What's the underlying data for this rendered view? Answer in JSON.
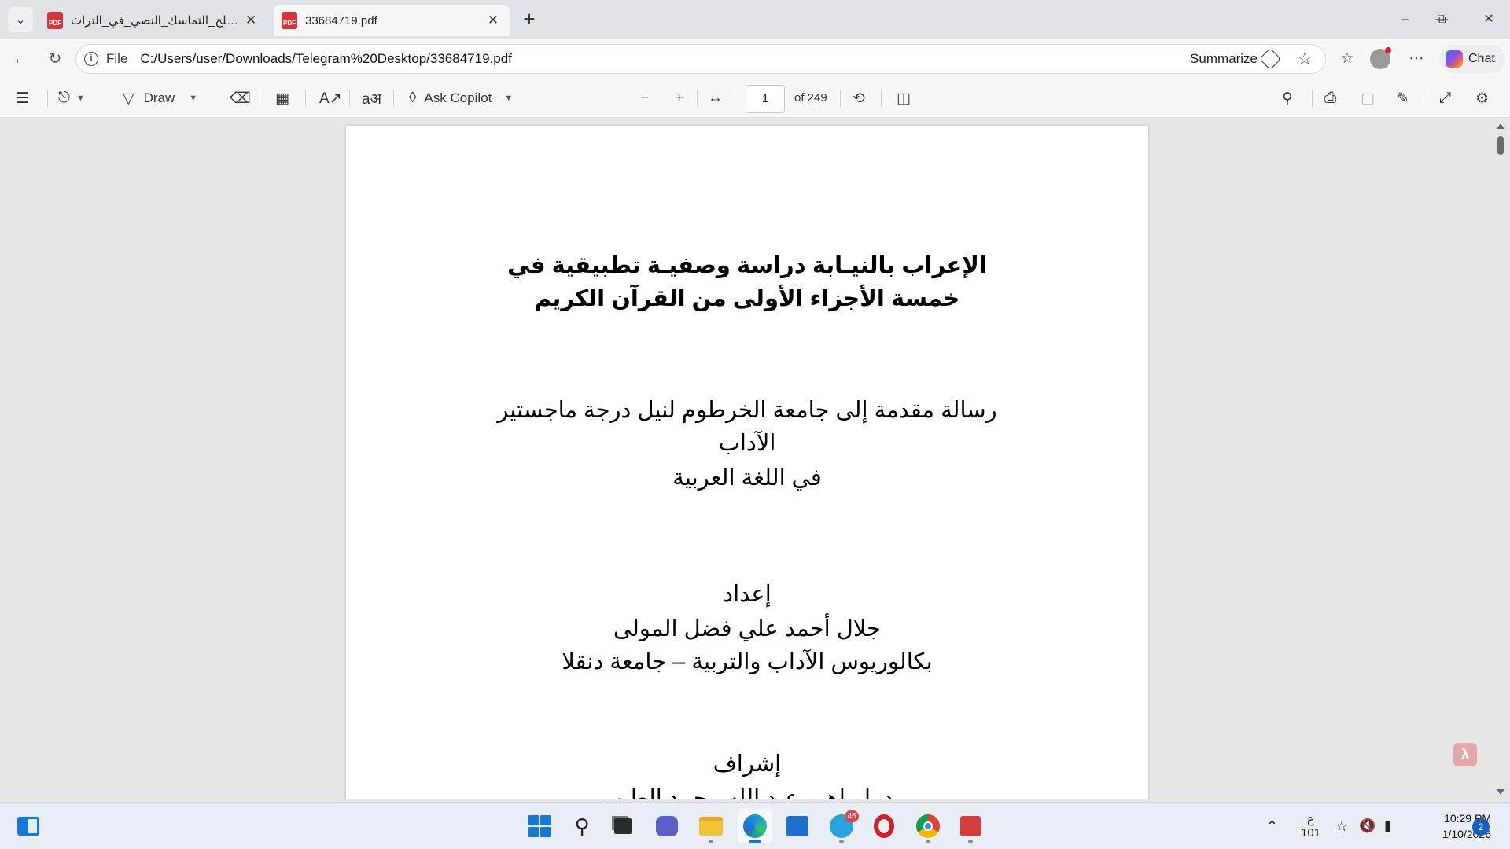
{
  "tabs": [
    {
      "title": "مصطلح_التماسك_النصي_في_التراث_...",
      "active": false
    },
    {
      "title": "33684719.pdf",
      "active": true
    }
  ],
  "address": {
    "scheme": "File",
    "url": "C:/Users/user/Downloads/Telegram%20Desktop/33684719.pdf",
    "summarize_label": "Summarize",
    "chat_label": "Chat"
  },
  "pdf_toolbar": {
    "draw_label": "Draw",
    "ask_copilot_label": "Ask Copilot",
    "current_page": "1",
    "page_count": "of 249"
  },
  "document": {
    "title_lines": [
      "الإعراب بالنيـابة دراسة وصفيـة تطبيقية في",
      "خمسة الأجزاء الأولى من القرآن الكريم"
    ],
    "degree_lines": [
      "رسالة مقدمة إلى جامعة الخرطوم لنيل درجة ماجستير",
      "الآداب",
      "في اللغة العربية"
    ],
    "prep_label": "إعداد",
    "author_name": "جلال أحمد علي فضل المولى",
    "author_degree": "بكالوريوس الآداب والتربية – جامعة دنقلا",
    "supervision_label": "إشراف",
    "supervisor_partial": "د. إبراهيم عبد الله محمد الطيب"
  },
  "taskbar": {
    "telegram_badge": "45",
    "ime_top": "ع",
    "ime_bottom": "101",
    "time": "10:29 PM",
    "date": "1/10/2026",
    "notifications": "2"
  },
  "colors": {
    "pdf_icon": "#d4343a",
    "accent_blue": "#1479d7",
    "opera_red": "#d0202a"
  }
}
